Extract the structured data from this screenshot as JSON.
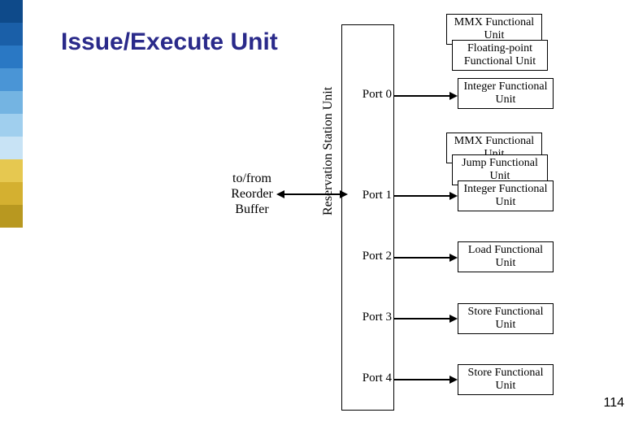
{
  "title": "Issue/Execute Unit",
  "slide_number": "114",
  "rob_label": "to/from Reorder Buffer",
  "rsu_label": "Reservation Station Unit",
  "ports": {
    "p0": "Port 0",
    "p1": "Port 1",
    "p2": "Port 2",
    "p3": "Port 3",
    "p4": "Port 4"
  },
  "units": {
    "p0_mmx": "MMX Functional Unit",
    "p0_fp": "Floating-point Functional Unit",
    "p0_int": "Integer Functional Unit",
    "p1_mmx": "MMX Functional Unit",
    "p1_jump": "Jump Functional Unit",
    "p1_int": "Integer Functional Unit",
    "p2_load": "Load Functional Unit",
    "p3_store": "Store Functional Unit",
    "p4_store": "Store Functional Unit"
  },
  "colorbar": [
    "#0e4a8a",
    "#1a5fa8",
    "#2a78c4",
    "#4a95d6",
    "#74b4e2",
    "#a0cfee",
    "#c8e3f5",
    "#e6c850",
    "#d4b030",
    "#b89820"
  ]
}
